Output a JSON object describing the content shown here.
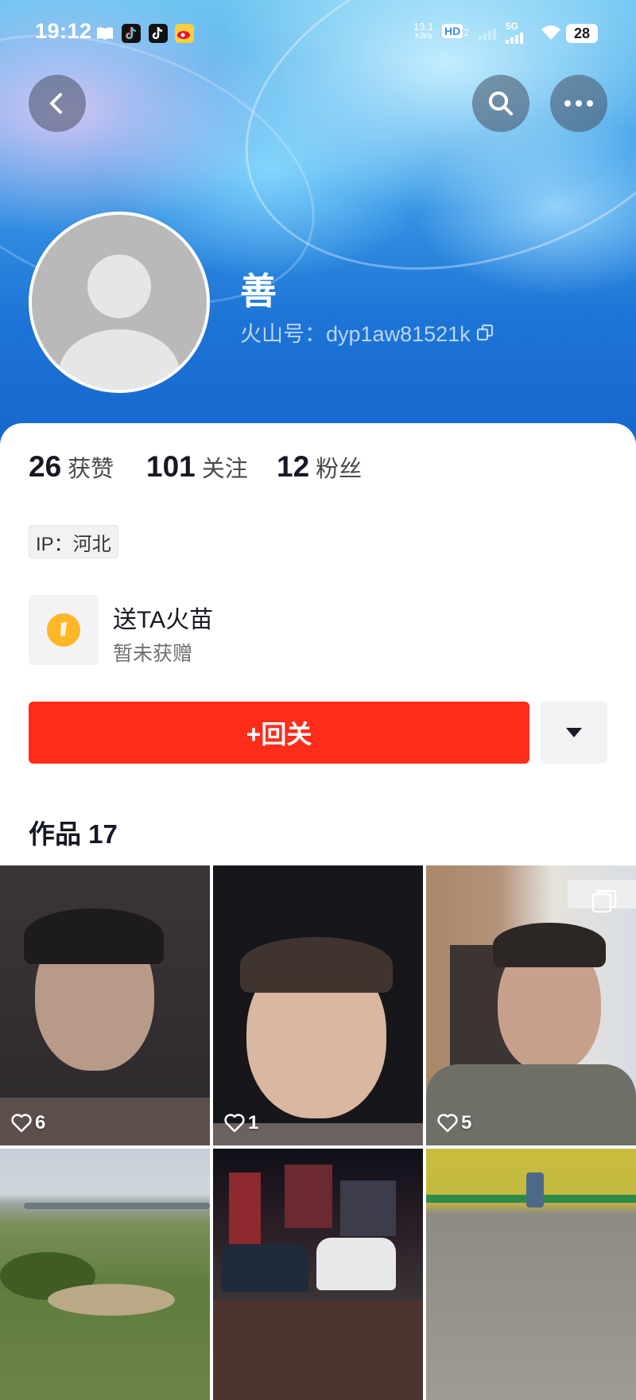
{
  "status_bar": {
    "time": "19:12",
    "net_speed_value": "13.1",
    "net_speed_unit": "KB/s",
    "hd_label": "HD",
    "hd_sub": "2",
    "signal_label": "5G",
    "battery": "28",
    "notification_icons": [
      "book-icon",
      "tiktok-icon",
      "tiktok-icon",
      "weibo-icon"
    ]
  },
  "header": {
    "back_icon": "back-icon",
    "search_icon": "search-icon",
    "more_icon": "more-icon"
  },
  "profile": {
    "name": "善",
    "account_id": "火山号：dyp1aw81521k"
  },
  "stats": [
    {
      "value": "26",
      "label": "获赞"
    },
    {
      "value": "101",
      "label": "关注"
    },
    {
      "value": "12",
      "label": "粉丝"
    }
  ],
  "ip_location": "IP：河北",
  "fire": {
    "title": "送TA火苗",
    "subtitle": "暂未获赠"
  },
  "actions": {
    "follow_back": "+回关"
  },
  "works": {
    "title": "作品 17",
    "items": [
      {
        "likes": "6"
      },
      {
        "likes": "1"
      },
      {
        "likes": "5"
      },
      {
        "likes": ""
      },
      {
        "likes": ""
      },
      {
        "likes": ""
      }
    ]
  }
}
